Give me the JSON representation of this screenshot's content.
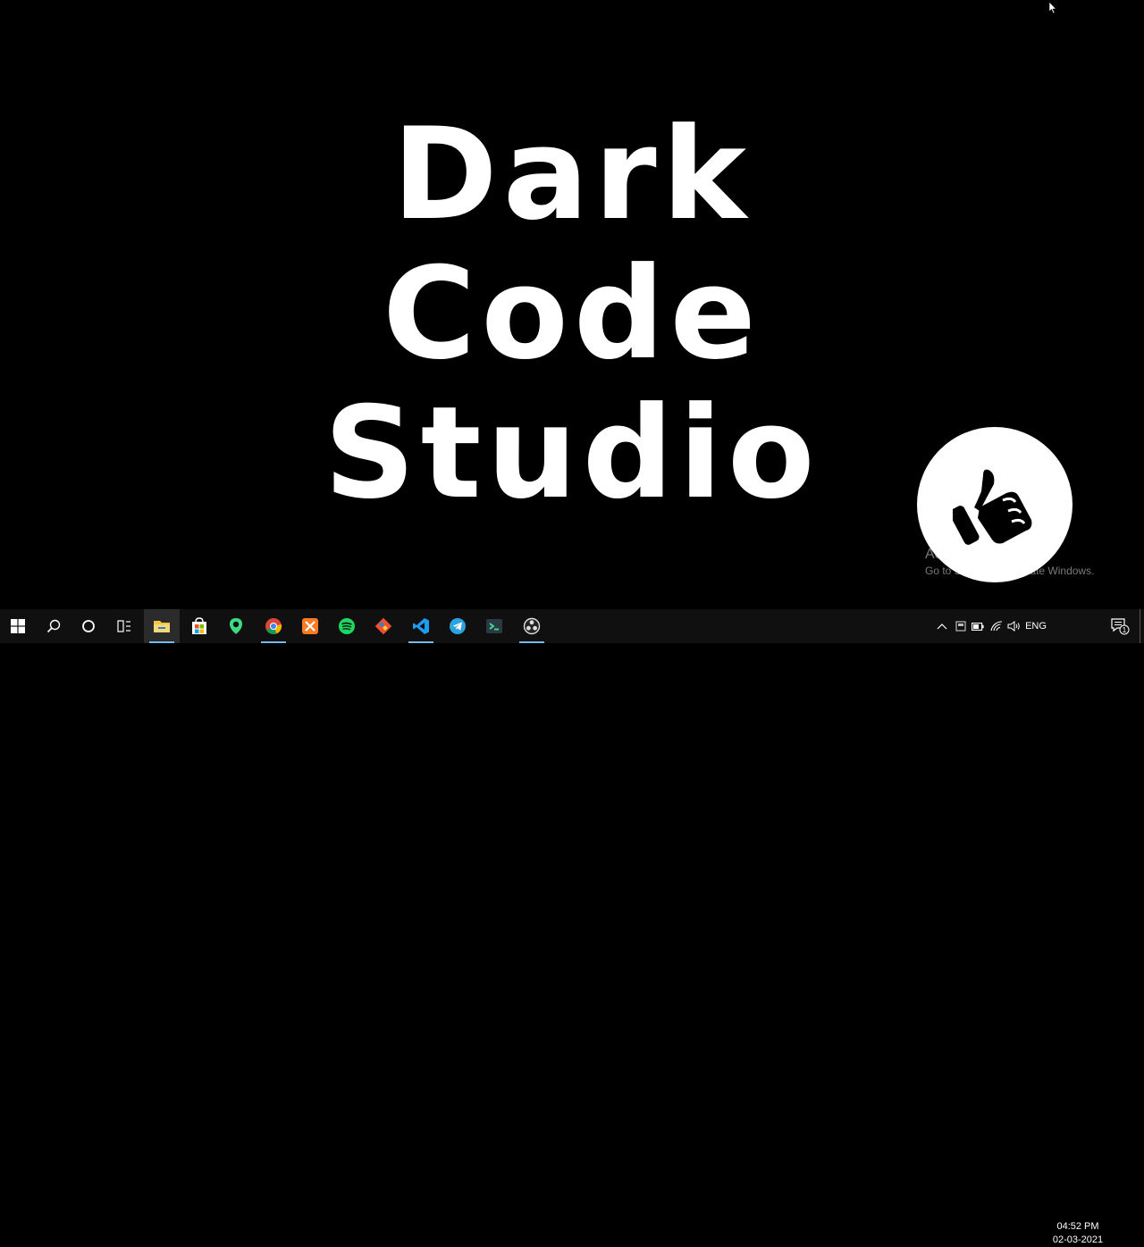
{
  "wallpaper": {
    "lines": [
      "Dark",
      "Code",
      "Studio"
    ]
  },
  "watermark": {
    "title": "Activate Windows",
    "subtitle": "Go to Settings to activate Windows."
  },
  "taskbar": {
    "pinned": [
      {
        "name": "start-button",
        "icon": "windows-logo-icon"
      },
      {
        "name": "search-button",
        "icon": "search-icon"
      },
      {
        "name": "cortana-button",
        "icon": "cortana-ring-icon"
      },
      {
        "name": "task-view-button",
        "icon": "task-view-icon"
      },
      {
        "name": "file-explorer-button",
        "icon": "folder-icon"
      },
      {
        "name": "microsoft-store-button",
        "icon": "store-bag-icon"
      },
      {
        "name": "maps-app-button",
        "icon": "map-pin-icon"
      },
      {
        "name": "chrome-button",
        "icon": "chrome-icon"
      },
      {
        "name": "xampp-button",
        "icon": "xampp-icon"
      },
      {
        "name": "spotify-button",
        "icon": "spotify-icon"
      },
      {
        "name": "git-button",
        "icon": "git-icon"
      },
      {
        "name": "vscode-button",
        "icon": "vscode-icon"
      },
      {
        "name": "telegram-button",
        "icon": "telegram-icon"
      },
      {
        "name": "terminal-app-button",
        "icon": "terminal-icon"
      },
      {
        "name": "obs-button",
        "icon": "obs-icon"
      }
    ],
    "tray": {
      "language": "ENG",
      "time": "04:52 PM",
      "date": "02-03-2021",
      "notification_count": "1"
    }
  },
  "colors": {
    "background": "#000000",
    "taskbar": "#101010",
    "accent": "#76b9ed"
  }
}
